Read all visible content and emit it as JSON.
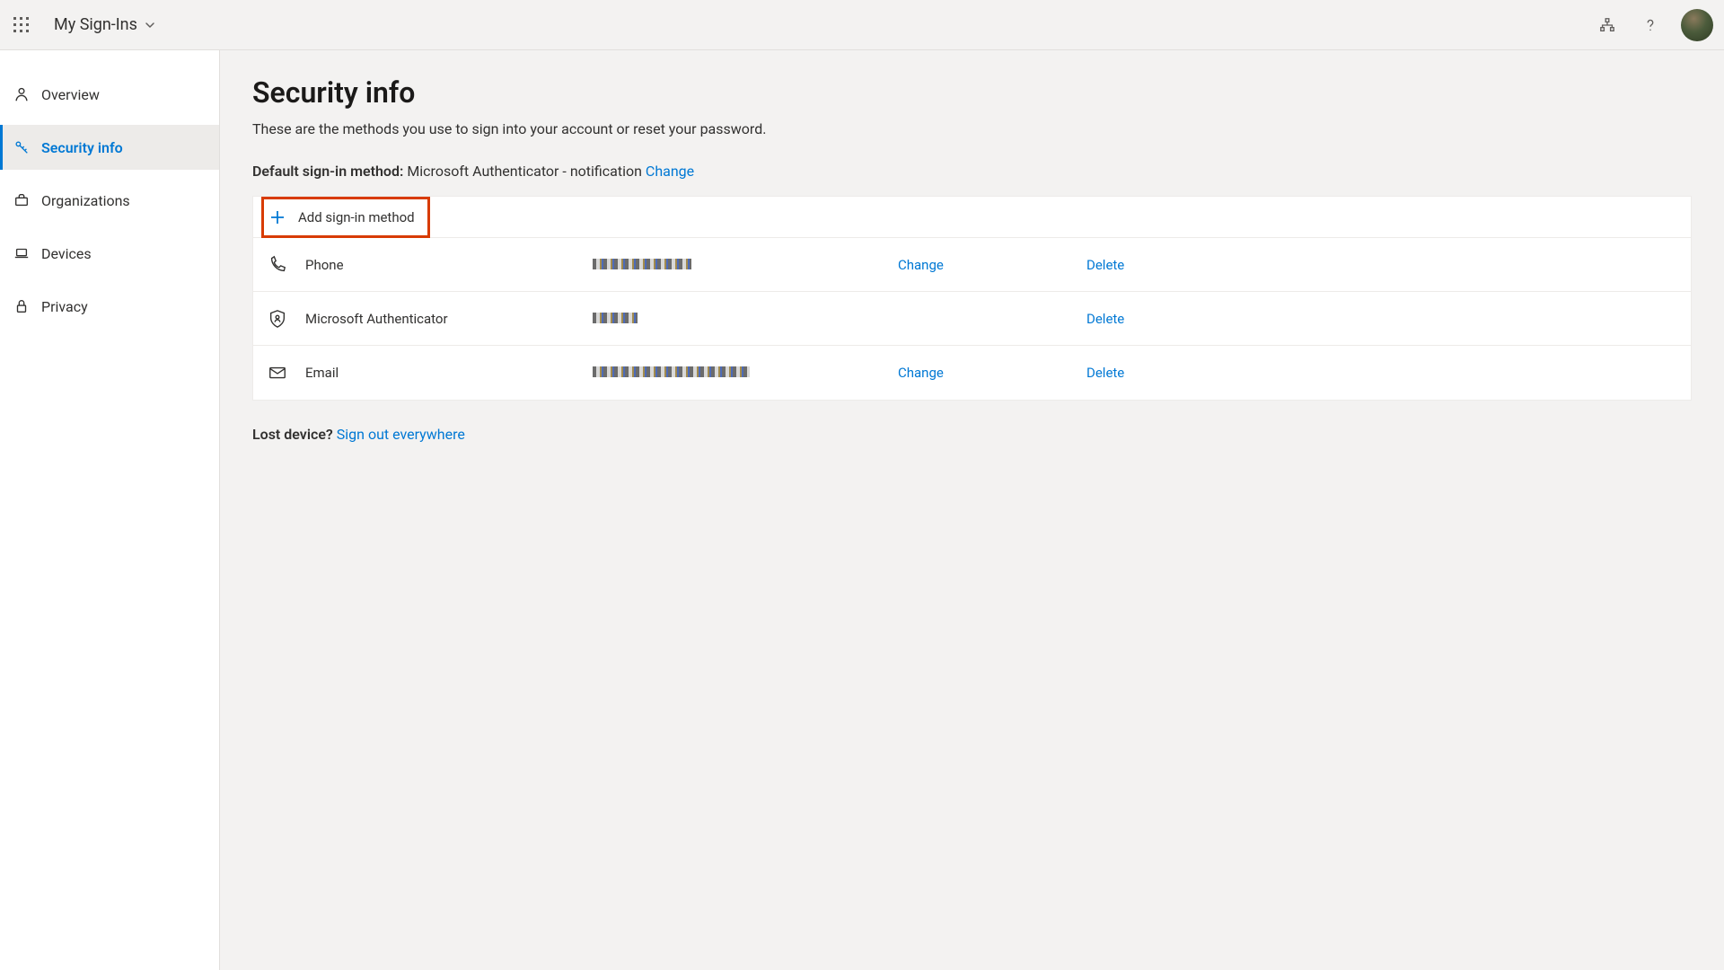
{
  "header": {
    "app_title": "My Sign-Ins"
  },
  "sidebar": {
    "items": [
      {
        "label": "Overview",
        "icon": "person"
      },
      {
        "label": "Security info",
        "icon": "key",
        "active": true
      },
      {
        "label": "Organizations",
        "icon": "briefcase"
      },
      {
        "label": "Devices",
        "icon": "laptop"
      },
      {
        "label": "Privacy",
        "icon": "lock"
      }
    ]
  },
  "page": {
    "title": "Security info",
    "subtitle": "These are the methods you use to sign into your account or reset your password.",
    "default_label": "Default sign-in method:",
    "default_value": "Microsoft Authenticator - notification",
    "change_link": "Change",
    "add_method": "Add sign-in method",
    "lost_device_q": "Lost device?",
    "signout_everywhere": "Sign out everywhere"
  },
  "methods": [
    {
      "icon": "phone",
      "label": "Phone",
      "value_redacted": true,
      "change": "Change",
      "delete": "Delete"
    },
    {
      "icon": "authenticator",
      "label": "Microsoft Authenticator",
      "value_redacted": true,
      "change": "",
      "delete": "Delete"
    },
    {
      "icon": "email",
      "label": "Email",
      "value_redacted": true,
      "change": "Change",
      "delete": "Delete"
    }
  ]
}
